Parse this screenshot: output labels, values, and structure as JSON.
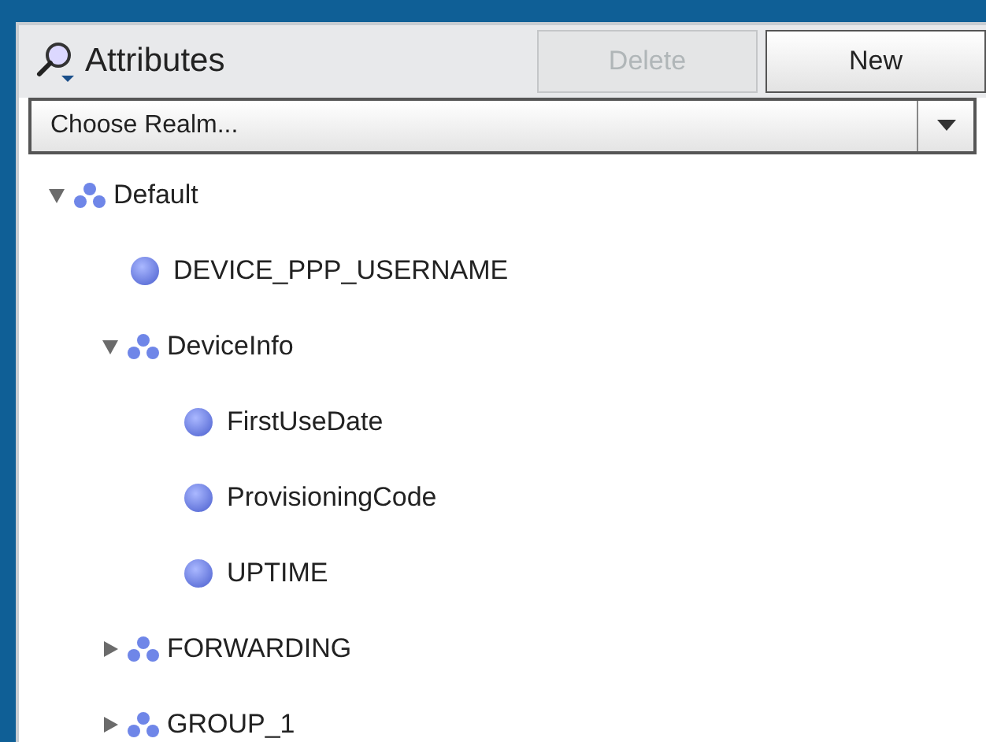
{
  "header": {
    "title": "Attributes",
    "buttons": [
      {
        "label": "Delete",
        "disabled": true
      },
      {
        "label": "New",
        "disabled": false
      }
    ]
  },
  "realm": {
    "value": "Choose Realm..."
  },
  "tree": [
    {
      "kind": "group",
      "label": "Default",
      "expanded": true,
      "children": [
        {
          "kind": "attribute",
          "label": "DEVICE_PPP_USERNAME"
        },
        {
          "kind": "group",
          "label": "DeviceInfo",
          "expanded": true,
          "children": [
            {
              "kind": "attribute",
              "label": "FirstUseDate"
            },
            {
              "kind": "attribute",
              "label": "ProvisioningCode"
            },
            {
              "kind": "attribute",
              "label": "UPTIME"
            }
          ]
        },
        {
          "kind": "group",
          "label": "FORWARDING",
          "expanded": false
        },
        {
          "kind": "group",
          "label": "GROUP_1",
          "expanded": false
        }
      ]
    }
  ]
}
